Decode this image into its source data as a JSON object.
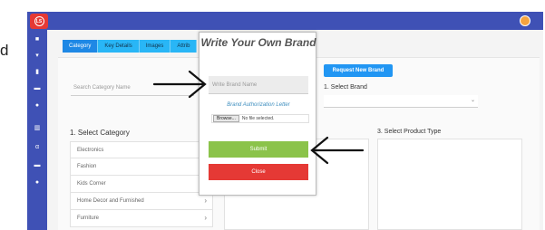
{
  "stray_text": "d",
  "header": {
    "logo_text": "LS"
  },
  "tabs": [
    {
      "label": "Category",
      "active": true
    },
    {
      "label": "Key Details",
      "active": false
    },
    {
      "label": "Images",
      "active": false
    },
    {
      "label": "Attrib",
      "active": false
    }
  ],
  "search": {
    "placeholder": "Search Category Name"
  },
  "category": {
    "title": "1. Select Category",
    "items": [
      {
        "label": "Electronics",
        "arrow": ""
      },
      {
        "label": "Fashion",
        "arrow": ""
      },
      {
        "label": "Kids Corner",
        "arrow": ""
      },
      {
        "label": "Home Decor and Furnished",
        "arrow": "›"
      },
      {
        "label": "Furniture",
        "arrow": "›"
      }
    ]
  },
  "brand": {
    "request_label": "Request New Brand",
    "select_label": "1. Select Brand"
  },
  "product_type": {
    "title": "3. Select Product Type"
  },
  "modal": {
    "title": "Write Your Own Brand",
    "input_placeholder": "Write Brand Name",
    "auth_label": "Brand Authorization Letter",
    "browse_label": "Browse...",
    "file_status": "No file selected.",
    "submit_label": "Submit",
    "close_label": "Close"
  },
  "colors": {
    "nav_bar": "#3f51b5",
    "tab_active": "#1e88e5",
    "tab_inactive": "#29b6f6",
    "submit": "#8bc34a",
    "close": "#e53935",
    "request_button": "#2196f3"
  }
}
